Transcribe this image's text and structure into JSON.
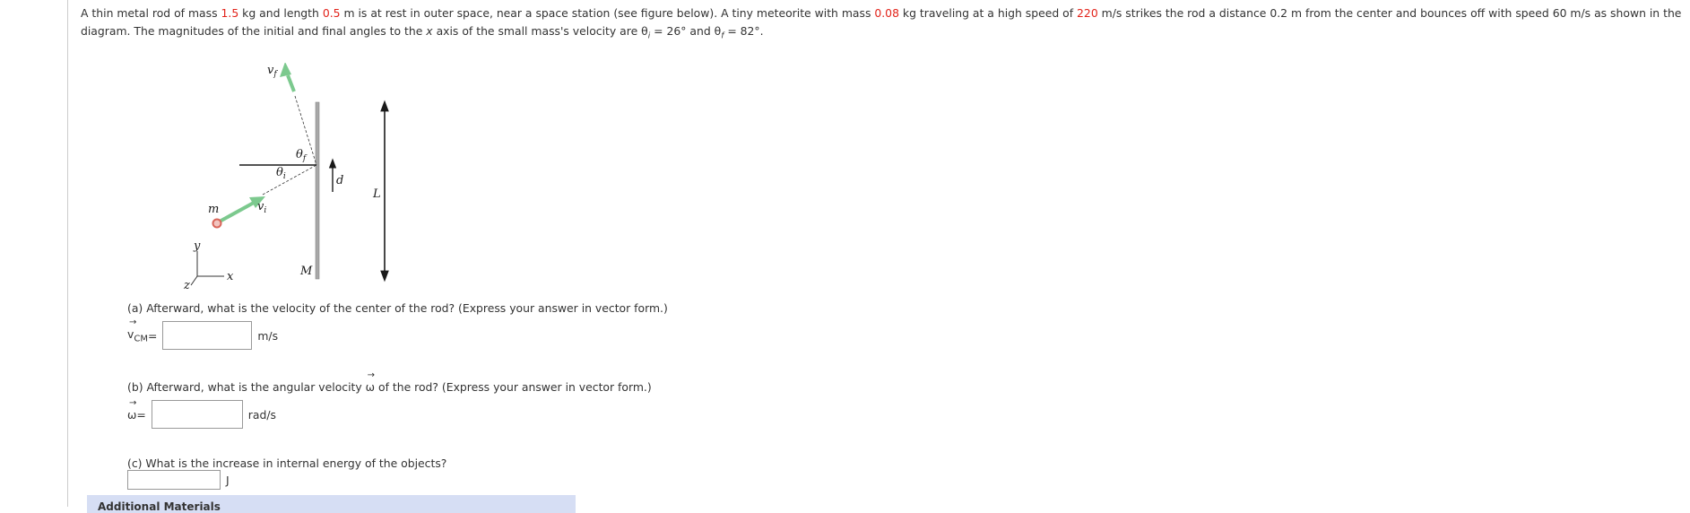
{
  "problem": {
    "parts": [
      {
        "t": "A thin metal rod of mass ",
        "c": ""
      },
      {
        "t": "1.5",
        "c": "red"
      },
      {
        "t": " kg and length ",
        "c": ""
      },
      {
        "t": "0.5",
        "c": "red"
      },
      {
        "t": " m is at rest in outer space, near a space station (see figure below). A tiny meteorite with mass ",
        "c": ""
      },
      {
        "t": "0.08",
        "c": "red"
      },
      {
        "t": " kg traveling at a high speed of ",
        "c": ""
      },
      {
        "t": "220",
        "c": "red"
      },
      {
        "t": " m/s strikes the rod a distance 0.2 m from the center and bounces off with speed 60 m/s as shown in the diagram. The magnitudes of the initial and final angles to the ",
        "c": ""
      },
      {
        "t": "x",
        "c": "ital"
      },
      {
        "t": " axis of the small mass's velocity are  θ",
        "c": ""
      },
      {
        "t": "i",
        "c": "sub"
      },
      {
        "t": " = 26°  and  θ",
        "c": ""
      },
      {
        "t": "f",
        "c": "sub"
      },
      {
        "t": " = 82°.",
        "c": ""
      }
    ]
  },
  "figure": {
    "labels": {
      "vf": "v",
      "vf_sub": "f",
      "vi": "v",
      "vi_sub": "i",
      "theta_f": "θ",
      "theta_f_sub": "f",
      "theta_i": "θ",
      "theta_i_sub": "i",
      "m": "m",
      "M": "M",
      "d": "d",
      "L": "L",
      "x": "x",
      "y": "y",
      "z": "z"
    },
    "colors": {
      "arrow_green": "#7cc98e",
      "mass_red": "#d9655a",
      "rod_gray": "#a8a8a8"
    }
  },
  "questions": {
    "a": {
      "text": "(a) Afterward, what is the velocity of the center of the rod? (Express your answer in vector form.)",
      "symbol": "v",
      "symbol_sub": "CM",
      "equals": " =",
      "value": "",
      "unit": "m/s"
    },
    "b": {
      "text_before": "(b) Afterward, what is the angular velocity ",
      "omega": "ω",
      "text_after": " of the rod? (Express your answer in vector form.)",
      "symbol": "ω",
      "equals": " =",
      "value": "",
      "unit": "rad/s"
    },
    "c": {
      "text": "(c) What is the increase in internal energy of the objects?",
      "value": "",
      "unit": "J"
    }
  },
  "additional": {
    "label": "Additional Materials"
  }
}
